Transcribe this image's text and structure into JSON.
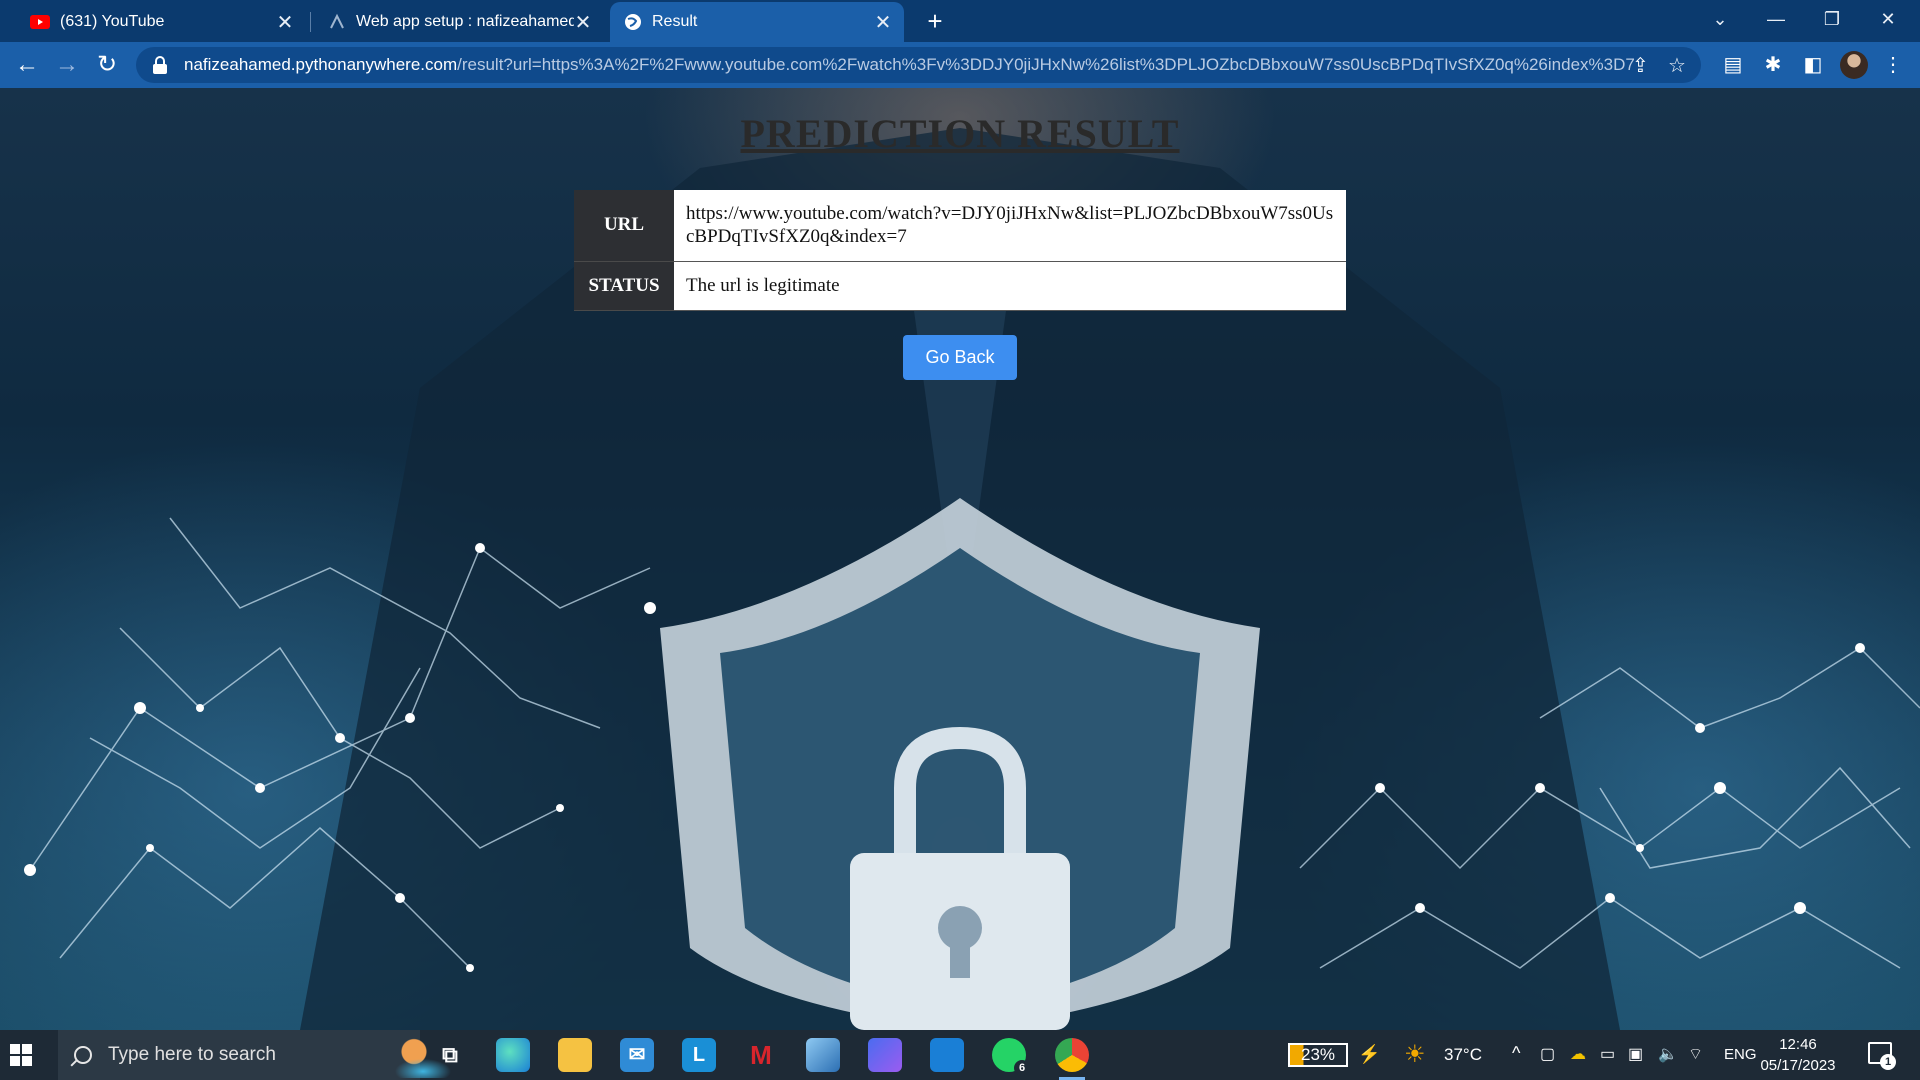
{
  "browser": {
    "tabs": [
      {
        "title": "(631) YouTube",
        "icon": "youtube-icon"
      },
      {
        "title": "Web app setup : nafizeahamed : ",
        "icon": "pythonanywhere-icon"
      },
      {
        "title": "Result",
        "icon": "globe-icon",
        "active": true
      }
    ],
    "url_host": "nafizeahamed.pythonanywhere.com",
    "url_path": "/result?url=https%3A%2F%2Fwww.youtube.com%2Fwatch%3Fv%3DDJY0jiJHxNw%26list%3DPLJOZbcDBbxouW7ss0UscBPDqTIvSfXZ0q%26index%3D7"
  },
  "page": {
    "title": "PREDICTION RESULT",
    "rows": [
      {
        "label": "URL",
        "value": "https://www.youtube.com/watch?v=DJY0jiJHxNw&list=PLJOZbcDBbxouW7ss0UscBPDqTIvSfXZ0q&index=7"
      },
      {
        "label": "STATUS",
        "value": "The url is legitimate"
      }
    ],
    "go_back_label": "Go Back"
  },
  "taskbar": {
    "search_placeholder": "Type here to search",
    "whatsapp_badge": "6",
    "battery": "23%",
    "temperature": "37°C",
    "language": "ENG",
    "time": "12:46",
    "date": "05/17/2023",
    "notification_count": "1"
  },
  "colors": {
    "tab_bar": "#0b3a6e",
    "toolbar": "#1b5fa9",
    "button": "#3d8ef0",
    "table_header": "#2d2f33"
  }
}
